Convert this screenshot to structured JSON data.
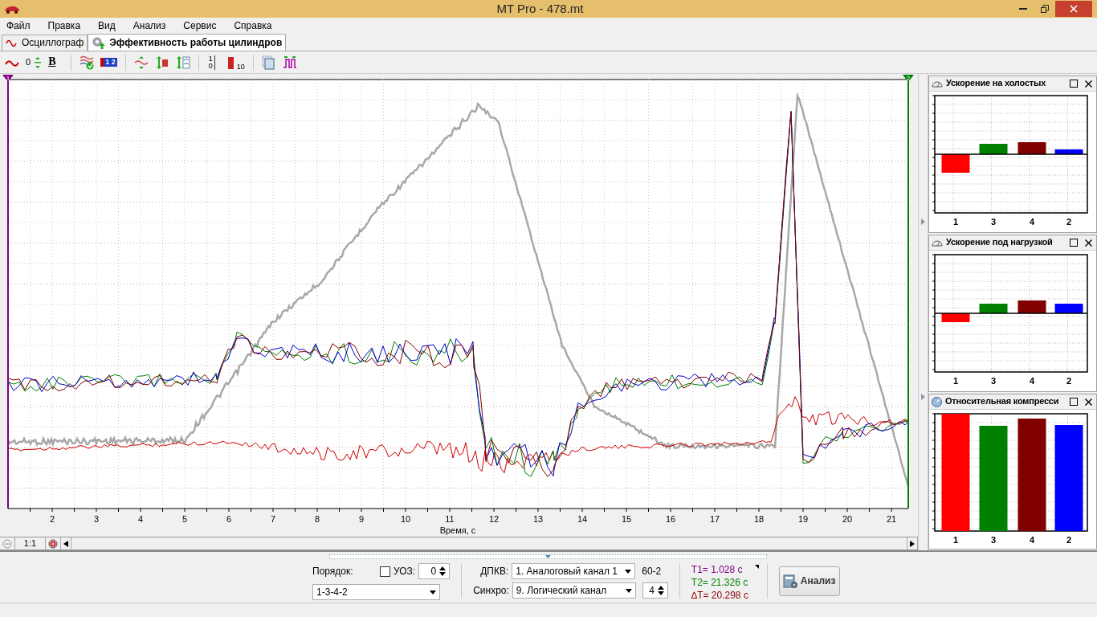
{
  "window": {
    "title": "MT Pro - 478.mt"
  },
  "menu": [
    "Файл",
    "Правка",
    "Вид",
    "Анализ",
    "Сервис",
    "Справка"
  ],
  "tabs": [
    {
      "label": "Осциллограф",
      "selected": false
    },
    {
      "label": "Эффективность работы цилиндров",
      "selected": true
    }
  ],
  "toolbar": [
    {
      "kind": "wave"
    },
    {
      "kind": "offset",
      "text": "0"
    },
    {
      "kind": "bold",
      "text": "B"
    },
    {
      "kind": "sep"
    },
    {
      "kind": "wavecheck"
    },
    {
      "kind": "numbers",
      "text": "1 2"
    },
    {
      "kind": "sep"
    },
    {
      "kind": "scale"
    },
    {
      "kind": "swap"
    },
    {
      "kind": "stack"
    },
    {
      "kind": "sep"
    },
    {
      "kind": "digits",
      "text": "1 0"
    },
    {
      "kind": "bar",
      "text": "10"
    },
    {
      "kind": "sep"
    },
    {
      "kind": "copy"
    },
    {
      "kind": "pulse"
    }
  ],
  "oscillogram": {
    "markers": [
      {
        "label": "1",
        "color": "#800080"
      },
      {
        "label": "2",
        "color": "#008000"
      }
    ],
    "x_ticks": [
      "2",
      "3",
      "4",
      "5",
      "6",
      "7",
      "8",
      "9",
      "10",
      "11",
      "12",
      "13",
      "14",
      "15",
      "16",
      "17",
      "18",
      "19",
      "20",
      "21"
    ],
    "x_label": "Время, с",
    "zoom": "1:1"
  },
  "panels": [
    {
      "title": "Ускорение на холостых",
      "bars": [
        {
          "label": "1",
          "color": "#ff0000"
        },
        {
          "label": "3",
          "color": "#008000"
        },
        {
          "label": "4",
          "color": "#800000"
        },
        {
          "label": "2",
          "color": "#0000ff"
        }
      ]
    },
    {
      "title": "Ускорение под нагрузкой",
      "bars": [
        {
          "label": "1",
          "color": "#ff0000"
        },
        {
          "label": "3",
          "color": "#008000"
        },
        {
          "label": "4",
          "color": "#800000"
        },
        {
          "label": "2",
          "color": "#0000ff"
        }
      ]
    },
    {
      "title": "Относительная компресси",
      "bars": [
        {
          "label": "1",
          "color": "#ff0000"
        },
        {
          "label": "3",
          "color": "#008000"
        },
        {
          "label": "4",
          "color": "#800000"
        },
        {
          "label": "2",
          "color": "#0000ff"
        }
      ]
    }
  ],
  "controls": {
    "order_label": "Порядок:",
    "order_value": "1-3-4-2",
    "uoz": {
      "label": "УОЗ:",
      "checked": false,
      "value": "0"
    },
    "dpkv": {
      "label": "ДПКВ:",
      "value": "1. Аналоговый канал 1",
      "note": "60-2"
    },
    "sync": {
      "label": "Синхро:",
      "value": "9. Логический канал",
      "count": "4"
    },
    "times": [
      {
        "text": "T1= 1.028 c",
        "color": "#800080"
      },
      {
        "text": "T2= 21.326 c",
        "color": "#008000"
      },
      {
        "text": "∆T= 20.298 c",
        "color": "#8b0000"
      }
    ],
    "analyze_button": "Анализ"
  }
}
